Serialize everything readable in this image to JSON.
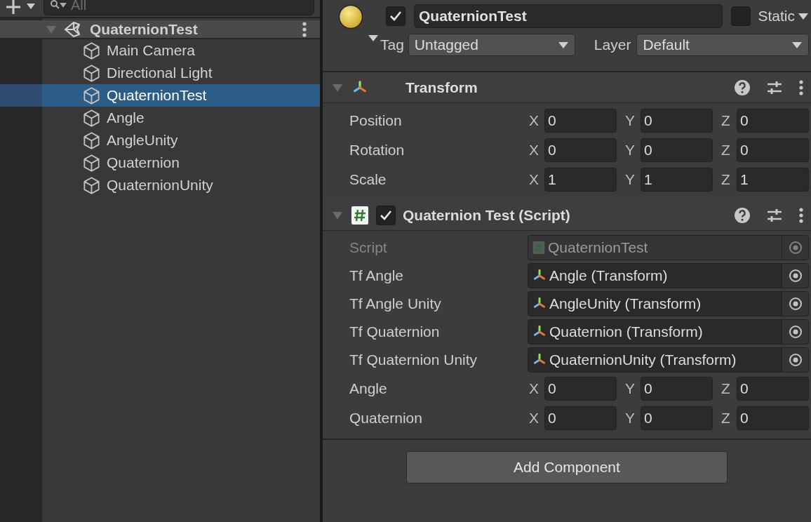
{
  "hierarchy": {
    "search": {
      "placeholder": "All"
    },
    "scene": {
      "name": "QuaternionTest",
      "expanded": true
    },
    "items": [
      {
        "name": "Main Camera",
        "selected": false
      },
      {
        "name": "Directional Light",
        "selected": false
      },
      {
        "name": "QuaternionTest",
        "selected": true
      },
      {
        "name": "Angle",
        "selected": false
      },
      {
        "name": "AngleUnity",
        "selected": false
      },
      {
        "name": "Quaternion",
        "selected": false
      },
      {
        "name": "QuaternionUnity",
        "selected": false
      }
    ]
  },
  "inspector": {
    "object": {
      "active": true,
      "name": "QuaternionTest",
      "static": false,
      "static_label": "Static",
      "tag_label": "Tag",
      "tag": "Untagged",
      "layer_label": "Layer",
      "layer": "Default"
    },
    "components": [
      {
        "kind": "transform",
        "title": "Transform",
        "expanded": true,
        "fields": [
          {
            "kind": "vector",
            "label": "Position",
            "axes": [
              {
                "axis": "X",
                "value": "0"
              },
              {
                "axis": "Y",
                "value": "0"
              },
              {
                "axis": "Z",
                "value": "0"
              }
            ]
          },
          {
            "kind": "vector",
            "label": "Rotation",
            "axes": [
              {
                "axis": "X",
                "value": "0"
              },
              {
                "axis": "Y",
                "value": "0"
              },
              {
                "axis": "Z",
                "value": "0"
              }
            ]
          },
          {
            "kind": "vector",
            "label": "Scale",
            "axes": [
              {
                "axis": "X",
                "value": "1"
              },
              {
                "axis": "Y",
                "value": "1"
              },
              {
                "axis": "Z",
                "value": "1"
              }
            ]
          }
        ]
      },
      {
        "kind": "script",
        "title": "Quaternion Test (Script)",
        "enabled": true,
        "expanded": true,
        "fields": [
          {
            "kind": "script_ref",
            "label": "Script",
            "value": "QuaternionTest",
            "disabled": true
          },
          {
            "kind": "object_ref",
            "label": "Tf Angle",
            "value": "Angle (Transform)",
            "disabled": false
          },
          {
            "kind": "object_ref",
            "label": "Tf Angle Unity",
            "value": "AngleUnity (Transform)",
            "disabled": false
          },
          {
            "kind": "object_ref",
            "label": "Tf Quaternion",
            "value": "Quaternion (Transform)",
            "disabled": false
          },
          {
            "kind": "object_ref",
            "label": "Tf Quaternion Unity",
            "value": "QuaternionUnity (Transform)",
            "disabled": false
          },
          {
            "kind": "vector",
            "label": "Angle",
            "axes": [
              {
                "axis": "X",
                "value": "0"
              },
              {
                "axis": "Y",
                "value": "0"
              },
              {
                "axis": "Z",
                "value": "0"
              }
            ]
          },
          {
            "kind": "vector",
            "label": "Quaternion",
            "axes": [
              {
                "axis": "X",
                "value": "0"
              },
              {
                "axis": "Y",
                "value": "0"
              },
              {
                "axis": "Z",
                "value": "0"
              }
            ]
          }
        ]
      }
    ],
    "add_component": "Add Component"
  }
}
